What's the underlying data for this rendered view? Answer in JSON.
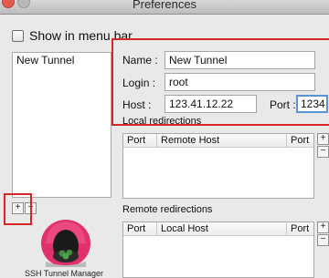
{
  "window": {
    "title": "Preferences"
  },
  "options": {
    "show_in_menu_bar": "Show in menu bar"
  },
  "sidebar": {
    "items": [
      {
        "label": "New Tunnel"
      }
    ]
  },
  "form": {
    "name_label": "Name :",
    "name_value": "New Tunnel",
    "login_label": "Login :",
    "login_value": "root",
    "host_label": "Host :",
    "host_value": "123.41.12.22",
    "port_label": "Port :",
    "port_value": "1234"
  },
  "local_redirections": {
    "title": "Local redirections",
    "headers": [
      "Port",
      "Remote Host",
      "Port"
    ]
  },
  "remote_redirections": {
    "title": "Remote redirections",
    "headers": [
      "Port",
      "Local Host",
      "Port"
    ]
  },
  "buttons": {
    "add": "+",
    "remove": "−"
  },
  "app": {
    "name": "SSH Tunnel Manager"
  },
  "colors": {
    "highlight": "#d62626",
    "focus": "#5b93d9"
  }
}
